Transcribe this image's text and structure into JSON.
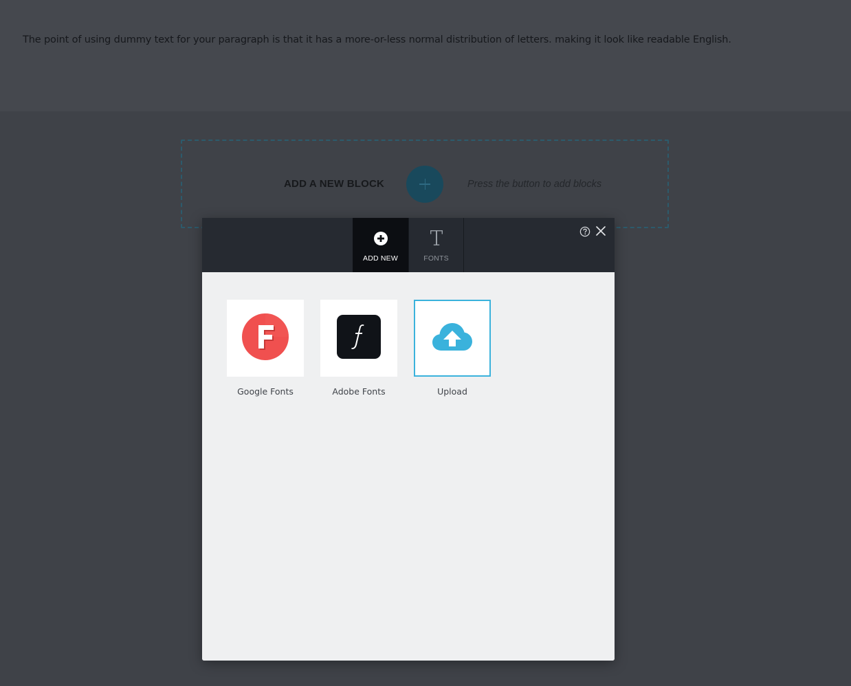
{
  "page": {
    "paragraph": "The point of using dummy text for your paragraph is that it has a more-or-less normal distribution of letters. making it look like readable English."
  },
  "add_block": {
    "label": "ADD A NEW BLOCK",
    "hint": "Press the button to add blocks"
  },
  "dialog": {
    "tabs": [
      {
        "label": "ADD NEW",
        "icon": "plus-circle-icon",
        "active": true
      },
      {
        "label": "FONTS",
        "icon": "font-t-icon",
        "active": false
      }
    ],
    "help_icon": "help-circle-icon",
    "close_icon": "close-icon",
    "cards": [
      {
        "label": "Google Fonts",
        "icon": "google-fonts-logo-icon",
        "selected": false
      },
      {
        "label": "Adobe Fonts",
        "icon": "adobe-fonts-logo-icon",
        "selected": false
      },
      {
        "label": "Upload",
        "icon": "cloud-upload-icon",
        "selected": true
      }
    ]
  },
  "colors": {
    "selection_accent": "#3ab2dc",
    "google_fonts_red": "#f0504f",
    "adobe_fonts_dark": "#101318",
    "upload_cloud": "#3ab2dc",
    "add_block_button": "#19495c"
  }
}
